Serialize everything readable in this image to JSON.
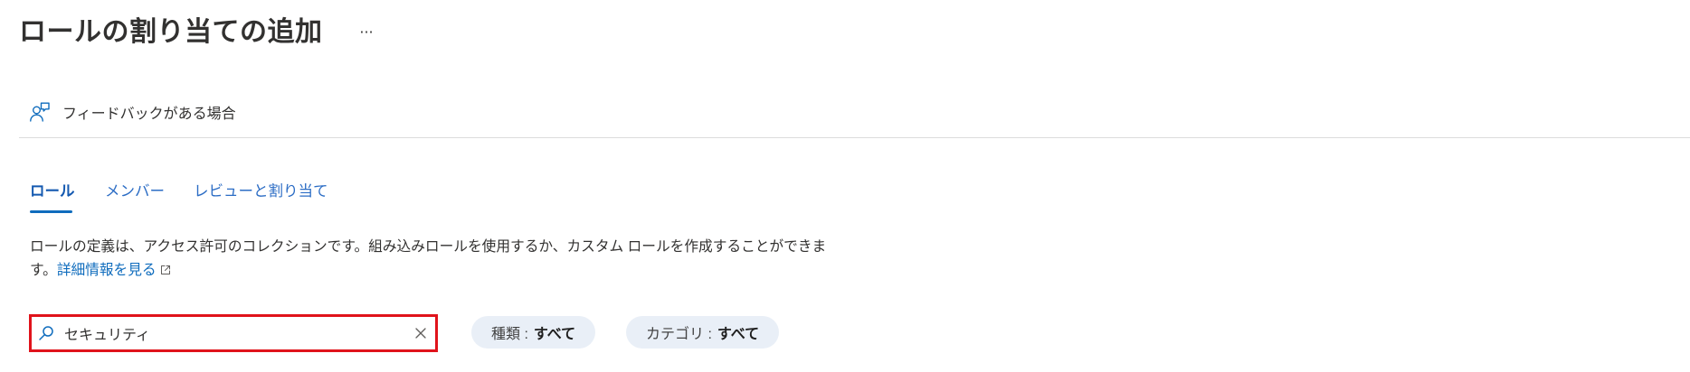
{
  "header": {
    "title": "ロールの割り当ての追加",
    "more_button": {
      "label": "···",
      "icon": "more-icon"
    }
  },
  "toolbar": {
    "feedback": {
      "label": "フィードバックがある場合",
      "icon": "feedback-icon"
    }
  },
  "tabs": [
    {
      "label": "ロール",
      "selected": true
    },
    {
      "label": "メンバー",
      "selected": false
    },
    {
      "label": "レビューと割り当て",
      "selected": false
    }
  ],
  "description": {
    "text": "ロールの定義は、アクセス許可のコレクションです。組み込みロールを使用するか、カスタム ロールを作成することができます。",
    "link_label": "詳細情報を見る",
    "link_icon": "external-link-icon"
  },
  "search": {
    "value": "セキュリティ",
    "icon": "search-icon",
    "clear_icon": "close-icon"
  },
  "filters": [
    {
      "label": "種類 :",
      "value": "すべて"
    },
    {
      "label": "カテゴリ :",
      "value": "すべて"
    }
  ],
  "colors": {
    "accent": "#0f6cbd",
    "text": "#323130",
    "highlight_border": "#e0131b",
    "pill_background": "#e9eff7"
  }
}
